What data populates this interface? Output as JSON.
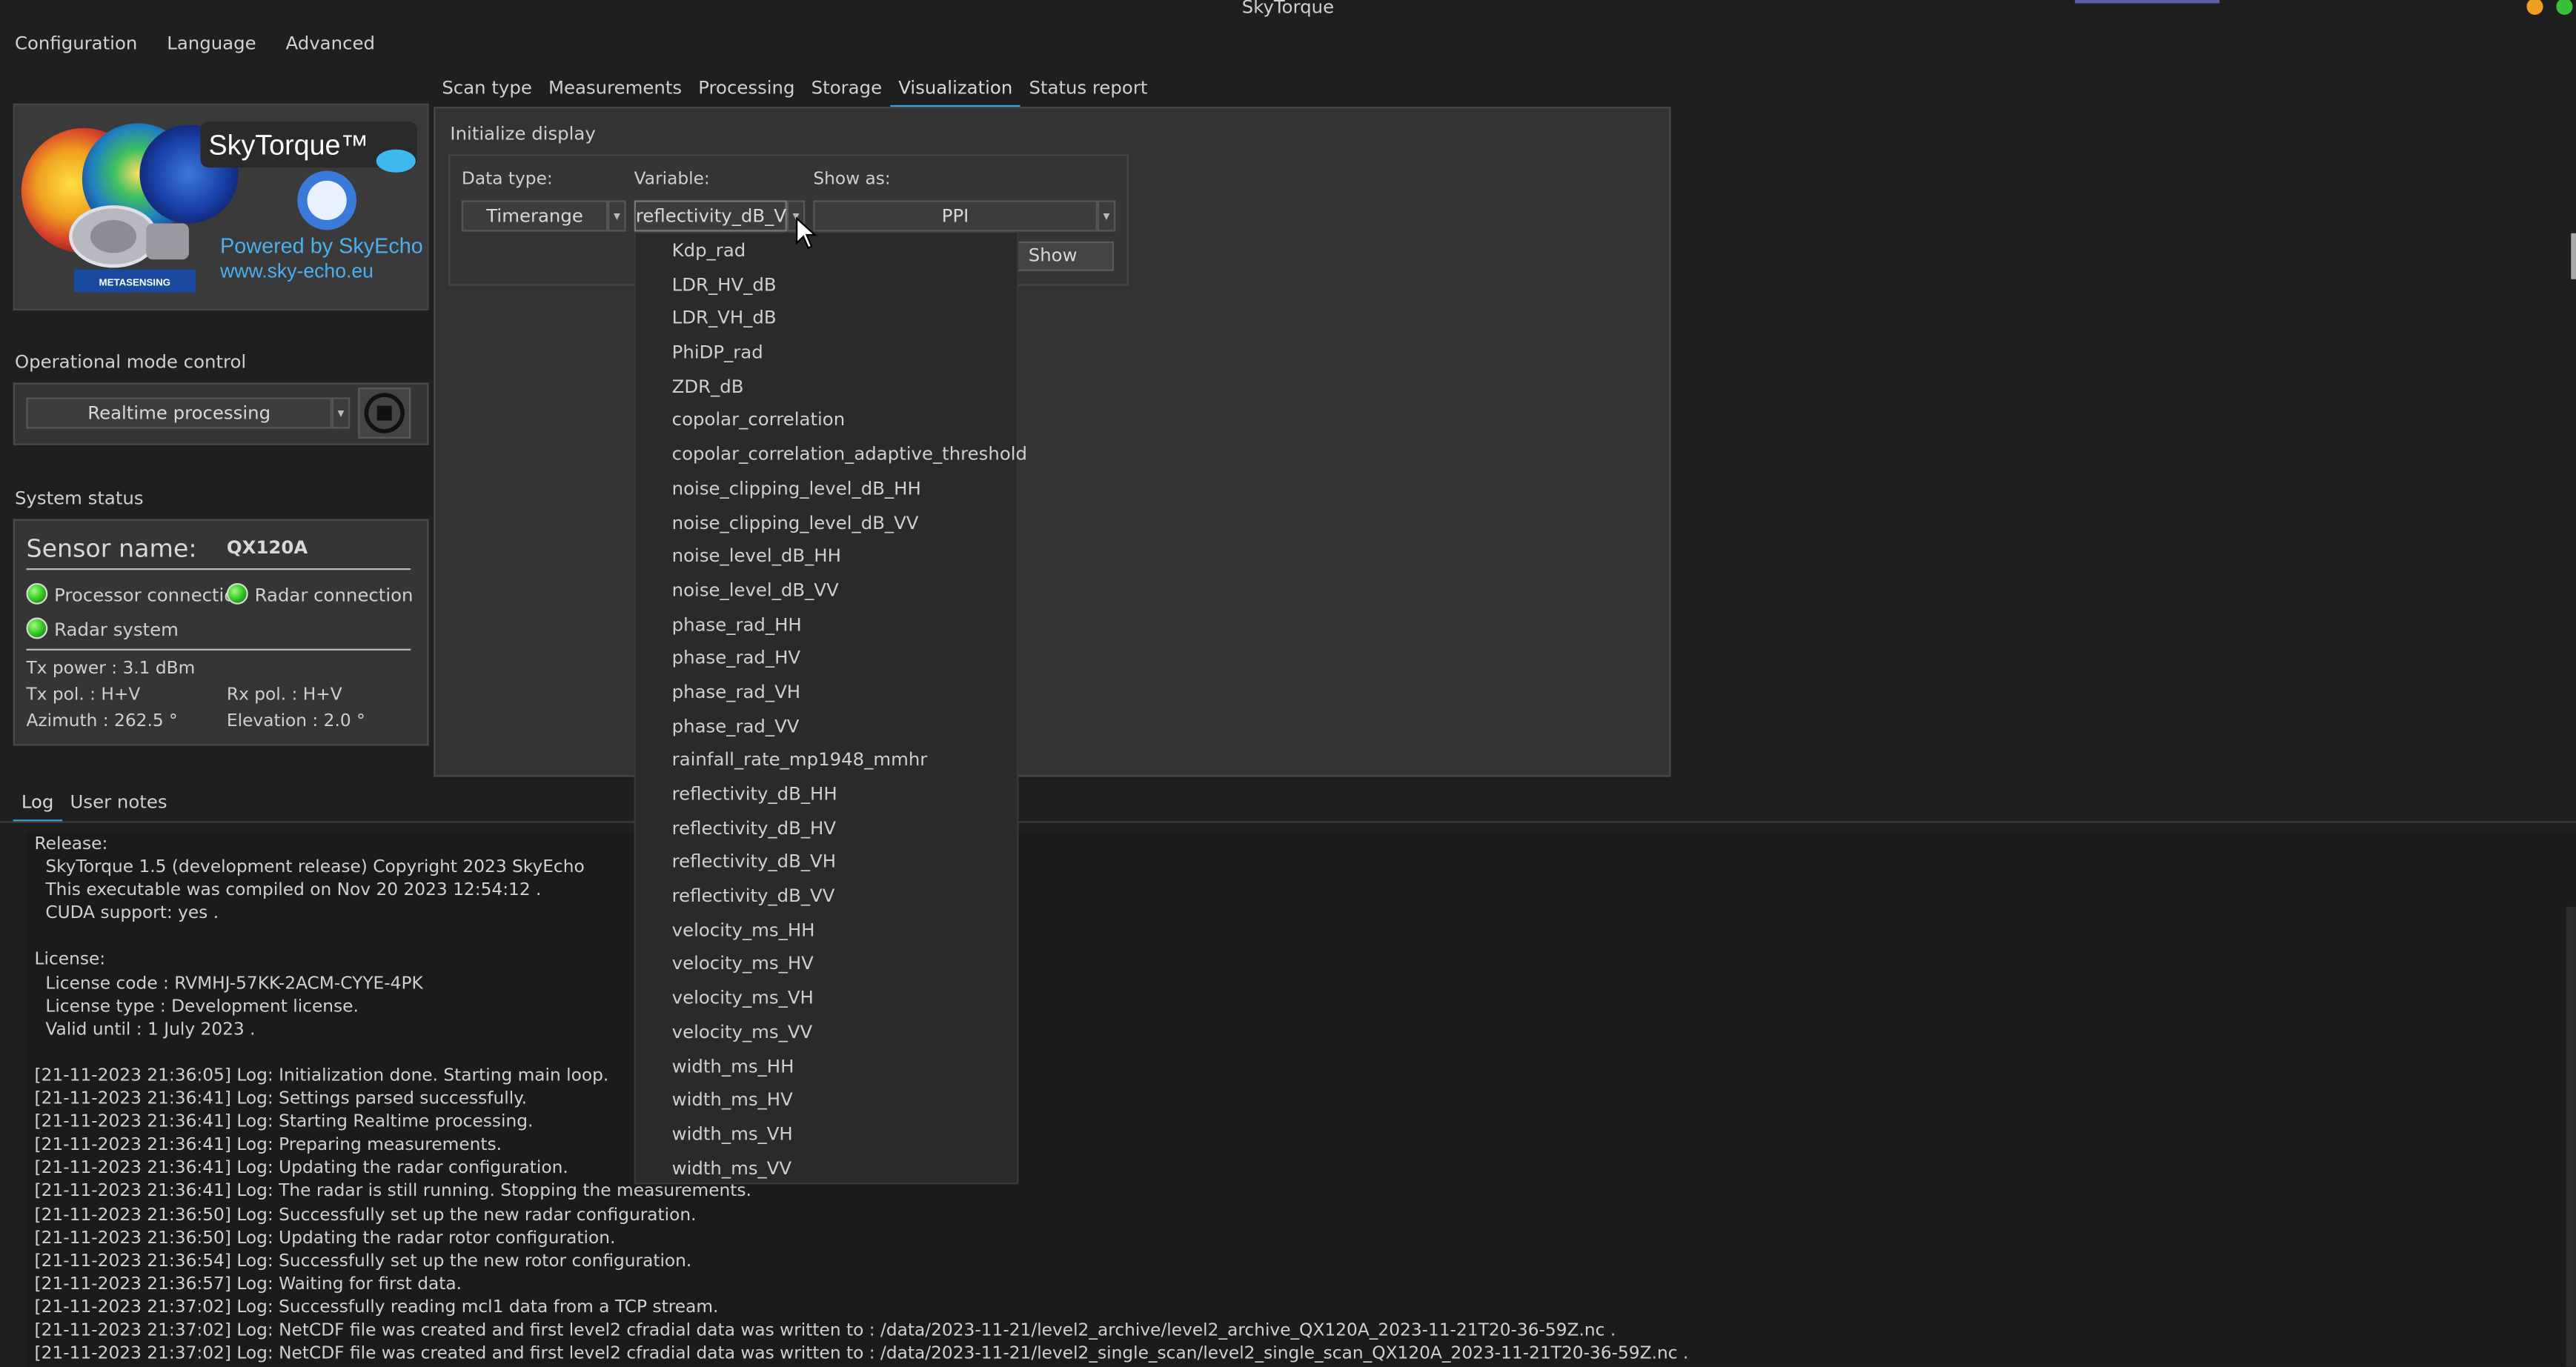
{
  "window": {
    "title": "SkyTorque"
  },
  "menu": [
    "Configuration",
    "Language",
    "Advanced"
  ],
  "logo": {
    "brand": "SkyTorque™",
    "powered": "Powered by SkyEcho",
    "url": "www.sky-echo.eu",
    "badge": "METASENSING"
  },
  "opmode": {
    "label": "Operational mode control",
    "value": "Realtime processing"
  },
  "status": {
    "label": "System status",
    "sensor_label": "Sensor name:",
    "sensor_value": "QX120A",
    "processor": "Processor connection",
    "radar_conn": "Radar connection",
    "radar_sys": "Radar system",
    "tx_power": "Tx power : 3.1 dBm",
    "tx_pol": "Tx pol. : H+V",
    "rx_pol": "Rx pol. : H+V",
    "azimuth": "Azimuth : 262.5 °",
    "elevation": "Elevation : 2.0 °"
  },
  "tabs": [
    "Scan type",
    "Measurements",
    "Processing",
    "Storage",
    "Visualization",
    "Status report"
  ],
  "viz": {
    "group": "Initialize display",
    "data_type_label": "Data type:",
    "data_type_value": "Timerange",
    "variable_label": "Variable:",
    "variable_value": "reflectivity_dB_VV",
    "show_as_label": "Show as:",
    "show_as_value": "PPI",
    "show_button": "Show"
  },
  "dropdown_items": [
    "Kdp_rad",
    "LDR_HV_dB",
    "LDR_VH_dB",
    "PhiDP_rad",
    "ZDR_dB",
    "copolar_correlation",
    "copolar_correlation_adaptive_threshold",
    "noise_clipping_level_dB_HH",
    "noise_clipping_level_dB_VV",
    "noise_level_dB_HH",
    "noise_level_dB_VV",
    "phase_rad_HH",
    "phase_rad_HV",
    "phase_rad_VH",
    "phase_rad_VV",
    "rainfall_rate_mp1948_mmhr",
    "reflectivity_dB_HH",
    "reflectivity_dB_HV",
    "reflectivity_dB_VH",
    "reflectivity_dB_VV",
    "velocity_ms_HH",
    "velocity_ms_HV",
    "velocity_ms_VH",
    "velocity_ms_VV",
    "width_ms_HH",
    "width_ms_HV",
    "width_ms_VH",
    "width_ms_VV"
  ],
  "bottom_tabs": [
    "Log",
    "User notes"
  ],
  "log_lines": [
    "Release:",
    "  SkyTorque 1.5 (development release) Copyright 2023 SkyEcho",
    "  This executable was compiled on Nov 20 2023 12:54:12 .",
    "  CUDA support: yes .",
    "",
    "License:",
    "  License code : RVMHJ-57KK-2ACM-CYYE-4PK",
    "  License type : Development license.",
    "  Valid until : 1 July 2023 .",
    "",
    "[21-11-2023 21:36:05] Log: Initialization done. Starting main loop.",
    "[21-11-2023 21:36:41] Log: Settings parsed successfully.",
    "[21-11-2023 21:36:41] Log: Starting Realtime processing.",
    "[21-11-2023 21:36:41] Log: Preparing measurements.",
    "[21-11-2023 21:36:41] Log: Updating the radar configuration.",
    "[21-11-2023 21:36:41] Log: The radar is still running. Stopping the measurements.",
    "[21-11-2023 21:36:50] Log: Successfully set up the new radar configuration.",
    "[21-11-2023 21:36:50] Log: Updating the radar rotor configuration.",
    "[21-11-2023 21:36:54] Log: Successfully set up the new rotor configuration.",
    "[21-11-2023 21:36:57] Log: Waiting for first data.",
    "[21-11-2023 21:37:02] Log: Successfully reading mcl1 data from a TCP stream.",
    "[21-11-2023 21:37:02] Log: NetCDF file was created and first level2 cfradial data was written to : /data/2023-11-21/level2_archive/level2_archive_QX120A_2023-11-21T20-36-59Z.nc .",
    "[21-11-2023 21:37:02] Log: NetCDF file was created and first level2 cfradial data was written to : /data/2023-11-21/level2_single_scan/level2_single_scan_QX120A_2023-11-21T20-36-59Z.nc ."
  ],
  "colors": {
    "accent": "#3d9fe0",
    "led_on": "#2fbf1f",
    "win_min": "#f0a020",
    "win_close": "#38c038"
  }
}
